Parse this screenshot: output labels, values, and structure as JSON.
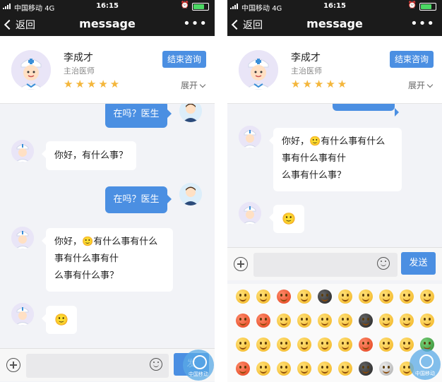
{
  "status_bar": {
    "carrier": "中国移动",
    "network": "4G",
    "time": "16:15"
  },
  "nav": {
    "back_label": "返回",
    "title": "message",
    "more_label": "•••"
  },
  "doctor": {
    "name": "李成才",
    "title": "主治医师",
    "stars": "★★★★★",
    "rating": 5,
    "end_button": "结束咨询",
    "expand_label": "展开"
  },
  "messages": {
    "user_1": "在吗？医生",
    "doctor_1": "你好，有什么事？",
    "user_2": "在吗？医生",
    "doctor_2_lines": [
      "你好，",
      "有什么事有什么",
      "事有什么事有什",
      "么事有什么事？"
    ],
    "emoji_glyph": "🙂"
  },
  "right_messages": {
    "doctor_lines": [
      "你好，",
      "有什么事有什么",
      "事有什么事有什",
      "么事有什么事？"
    ],
    "emoji_glyph": "🙂"
  },
  "input": {
    "placeholder": "",
    "send_label": "发送",
    "send_label_partial": "发"
  },
  "watermark": {
    "text": "中国移动"
  },
  "colors": {
    "accent": "#4b8fe2",
    "nav_bg": "#1b1b1b",
    "chat_bg": "#f2f3f7",
    "star": "#f4b63b"
  }
}
